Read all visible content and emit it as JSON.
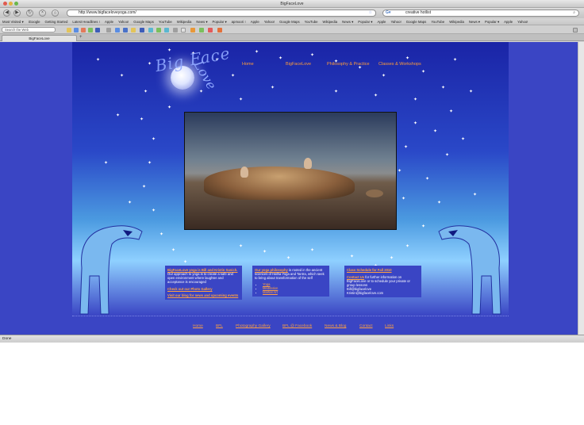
{
  "window": {
    "title": "BigFaceLove"
  },
  "nav": {
    "back": "◀",
    "forward": "▶",
    "reload": "↻",
    "home": "⌂",
    "url": "http://www.bigfaceloveyoga.com/",
    "search_value": "creative hotlist"
  },
  "bookmarks": [
    "Most Visited ▾",
    "iGoogle",
    "Getting Started",
    "Latest Headlines ⁝",
    "Apple",
    "Yahoo!",
    "Google Maps",
    "YouTube",
    "Wikipedia",
    "News ▾",
    "Popular ▾",
    "apmoori ⁝",
    "Apple",
    "Yahoo!",
    "Google Maps",
    "YouTube",
    "Wikipedia",
    "News ▾",
    "Popular ▾",
    "Apple",
    "Yahoo!",
    "Google Maps",
    "YouTube",
    "Wikipedia",
    "News ▾",
    "Popular ▾",
    "Apple",
    "Yahoo!"
  ],
  "toolbar": {
    "web_search_placeholder": "Search the Web"
  },
  "tab": {
    "label": "BigFaceLove",
    "new_tab": "+"
  },
  "site": {
    "logo": {
      "big": "Big Face",
      "love": "Love"
    },
    "menu": [
      "Home",
      "BigFaceLove",
      "Philosophy & Practice",
      "Classes & Workshops"
    ],
    "col1": {
      "lead_link": "BigFaceLove yoga is Bill and Kristin Sanich.",
      "lead_text": " Our approach to yoga is to create a safe and open environment where laughter and acceptance is encouraged",
      "photo_link": "Check out our Photo Gallery",
      "blog_link": "Visit our blog for news and upcoming events"
    },
    "col2": {
      "philosophy_link": "Our yoga philosophy",
      "philosophy_text": " is rooted in the ancient sciences of Hatha Yoga and Tantra, which seek to bring about transformation of the self",
      "items": [
        "Yoga",
        "Meditation",
        "Martial Art"
      ]
    },
    "col3": {
      "schedule_link": "Class Schedule for Fall 2010",
      "contact_link": "Contact Us",
      "contact_text": " for further information on BigFaceLove or to schedule your private or group lessons",
      "email1": "Bill@bigfacelove",
      "email2": "Kristin@bigfacelove.com"
    },
    "footer": [
      "Home",
      "BFL",
      "Photography Gallery",
      "BFL @ Facebook",
      "News & Blog",
      "Contact",
      "Links"
    ]
  },
  "status": {
    "text": "Done"
  },
  "colors": {
    "accent": "#ffa040",
    "page_bg": "#3a45c4"
  }
}
